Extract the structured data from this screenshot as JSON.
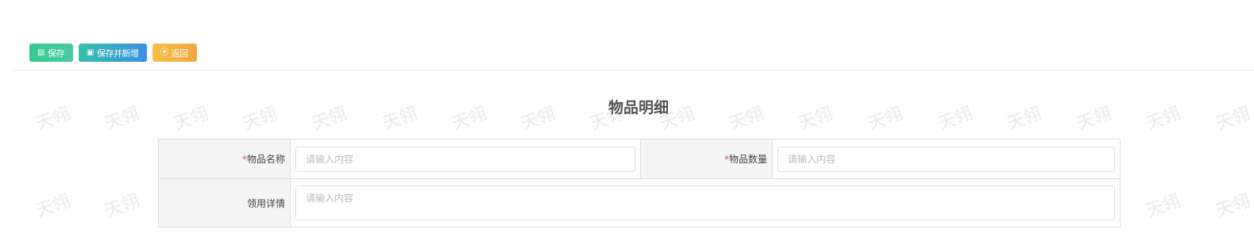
{
  "toolbar": {
    "save_label": "保存",
    "save_new_label": "保存并新增",
    "back_label": "返回"
  },
  "watermark_text": "天翎",
  "form": {
    "title": "物品明细",
    "item_name_label": "物品名称",
    "item_qty_label": "物品数量",
    "detail_label": "领用详情",
    "required_mark": "*",
    "placeholder": "请输入内容"
  }
}
